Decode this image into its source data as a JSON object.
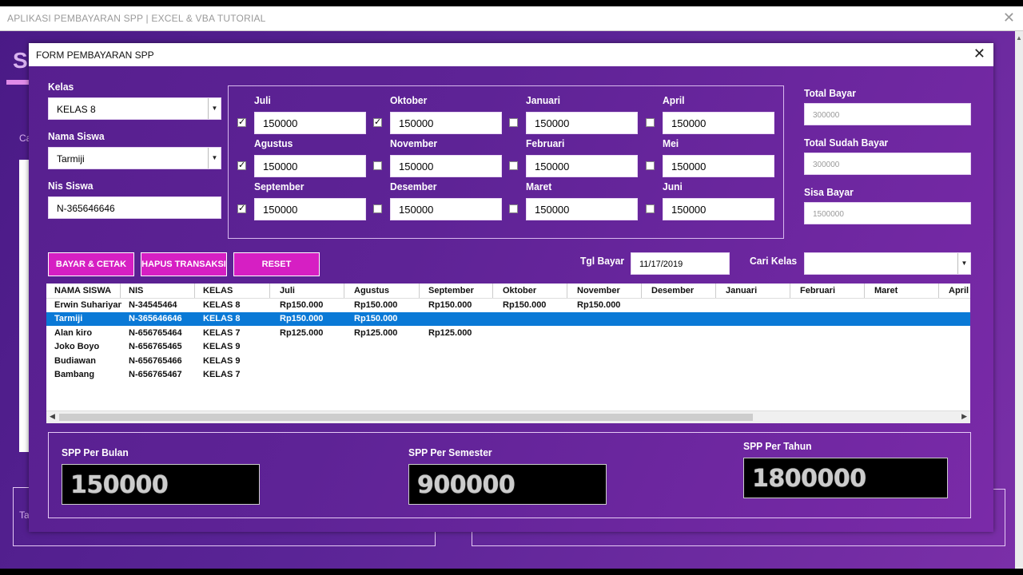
{
  "app": {
    "title": "APLIKASI PEMBAYARAN SPP | EXCEL & VBA TUTORIAL",
    "close": "✕",
    "bg_fragments": [
      "S",
      "Ca",
      "Ta"
    ]
  },
  "form": {
    "title": "FORM PEMBAYARAN SPP",
    "close": "✕",
    "kelas": {
      "label": "Kelas",
      "value": "KELAS 8"
    },
    "nama_siswa": {
      "label": "Nama Siswa",
      "value": "Tarmiji"
    },
    "nis_siswa": {
      "label": "Nis Siswa",
      "value": "N-365646646"
    },
    "months": [
      {
        "name": "Juli",
        "value": "150000",
        "checked": true
      },
      {
        "name": "Oktober",
        "value": "150000",
        "checked": true
      },
      {
        "name": "Januari",
        "value": "150000",
        "checked": false
      },
      {
        "name": "April",
        "value": "150000",
        "checked": false
      },
      {
        "name": "Agustus",
        "value": "150000",
        "checked": true
      },
      {
        "name": "November",
        "value": "150000",
        "checked": false
      },
      {
        "name": "Februari",
        "value": "150000",
        "checked": false
      },
      {
        "name": "Mei",
        "value": "150000",
        "checked": false
      },
      {
        "name": "September",
        "value": "150000",
        "checked": true
      },
      {
        "name": "Desember",
        "value": "150000",
        "checked": false
      },
      {
        "name": "Maret",
        "value": "150000",
        "checked": false
      },
      {
        "name": "Juni",
        "value": "150000",
        "checked": false
      }
    ],
    "total_bayar": {
      "label": "Total Bayar",
      "value": "300000"
    },
    "total_sudah_bayar": {
      "label": "Total Sudah Bayar",
      "value": "300000"
    },
    "sisa_bayar": {
      "label": "Sisa Bayar",
      "value": "1500000"
    },
    "buttons": {
      "bayar": "BAYAR & CETAK",
      "hapus": "HAPUS TRANSAKSI",
      "reset": "RESET"
    },
    "tgl_bayar": {
      "label": "Tgl Bayar",
      "value": "11/17/2019"
    },
    "cari_kelas": {
      "label": "Cari Kelas",
      "value": ""
    },
    "table": {
      "columns": [
        "NAMA SISWA",
        "NIS",
        "KELAS",
        "Juli",
        "Agustus",
        "September",
        "Oktober",
        "November",
        "Desember",
        "Januari",
        "Februari",
        "Maret",
        "April"
      ],
      "rows": [
        [
          "Erwin Suhariyanto",
          "N-34545464",
          "KELAS 8",
          "Rp150.000",
          "Rp150.000",
          "Rp150.000",
          "Rp150.000",
          "Rp150.000"
        ],
        [
          "Tarmiji",
          "N-365646646",
          "KELAS 8",
          "Rp150.000",
          "Rp150.000"
        ],
        [
          "Alan kiro",
          "N-656765464",
          "KELAS 7",
          "Rp125.000",
          "Rp125.000",
          "Rp125.000"
        ],
        [
          "Joko Boyo",
          "N-656765465",
          "KELAS 9"
        ],
        [
          "Budiawan",
          "N-656765466",
          "KELAS 9"
        ],
        [
          "Bambang",
          "N-656765467",
          "KELAS 7"
        ]
      ],
      "selected_row": 1
    },
    "summary": {
      "per_bulan": {
        "label": "SPP Per Bulan",
        "value": "150000"
      },
      "per_semester": {
        "label": "SPP Per Semester",
        "value": "900000"
      },
      "per_tahun": {
        "label": "SPP Per Tahun",
        "value": "1800000"
      }
    },
    "colors": {
      "accent": "#d61fc3",
      "selection": "#0a79d6",
      "bg_start": "#571f8f",
      "bg_end": "#7a2aa8"
    }
  }
}
